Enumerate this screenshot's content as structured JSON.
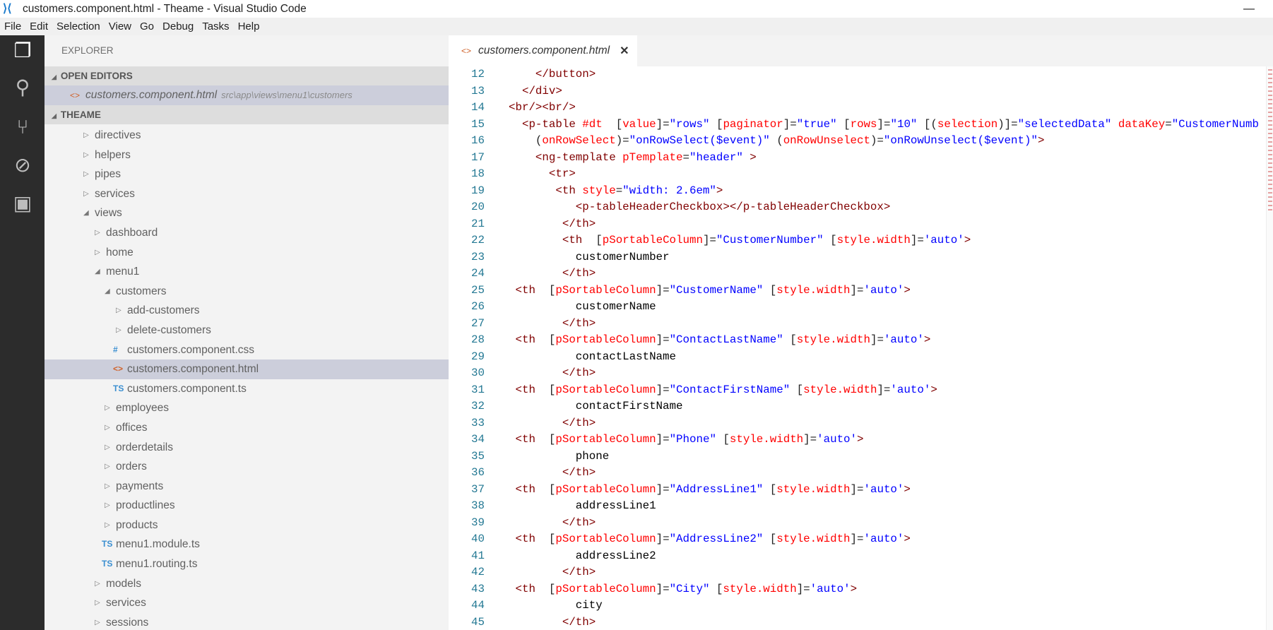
{
  "window": {
    "title": "customers.component.html - Theame - Visual Studio Code",
    "minimize": "—",
    "app_icon": "vscode-logo-icon"
  },
  "menu": [
    "File",
    "Edit",
    "Selection",
    "View",
    "Go",
    "Debug",
    "Tasks",
    "Help"
  ],
  "activity": [
    "files-icon",
    "search-icon",
    "source-control-icon",
    "debug-icon",
    "extensions-icon"
  ],
  "sidebar": {
    "title": "EXPLORER",
    "open_editors": {
      "label": "OPEN EDITORS",
      "file": "customers.component.html",
      "path": "src\\app\\views\\menu1\\customers"
    },
    "project": {
      "label": "THEAME"
    },
    "tree": [
      {
        "label": "directives",
        "level": 0,
        "type": "folder",
        "expanded": false
      },
      {
        "label": "helpers",
        "level": 0,
        "type": "folder",
        "expanded": false
      },
      {
        "label": "pipes",
        "level": 0,
        "type": "folder",
        "expanded": false
      },
      {
        "label": "services",
        "level": 0,
        "type": "folder",
        "expanded": false
      },
      {
        "label": "views",
        "level": 0,
        "type": "folder",
        "expanded": true
      },
      {
        "label": "dashboard",
        "level": 1,
        "type": "folder",
        "expanded": false
      },
      {
        "label": "home",
        "level": 1,
        "type": "folder",
        "expanded": false
      },
      {
        "label": "menu1",
        "level": 1,
        "type": "folder",
        "expanded": true
      },
      {
        "label": "customers",
        "level": 2,
        "type": "folder",
        "expanded": true
      },
      {
        "label": "add-customers",
        "level": 3,
        "type": "folder",
        "expanded": false
      },
      {
        "label": "delete-customers",
        "level": 3,
        "type": "folder",
        "expanded": false
      },
      {
        "label": "customers.component.css",
        "level": 3,
        "type": "css"
      },
      {
        "label": "customers.component.html",
        "level": 3,
        "type": "html",
        "selected": true
      },
      {
        "label": "customers.component.ts",
        "level": 3,
        "type": "ts"
      },
      {
        "label": "employees",
        "level": 2,
        "type": "folder",
        "expanded": false
      },
      {
        "label": "offices",
        "level": 2,
        "type": "folder",
        "expanded": false
      },
      {
        "label": "orderdetails",
        "level": 2,
        "type": "folder",
        "expanded": false
      },
      {
        "label": "orders",
        "level": 2,
        "type": "folder",
        "expanded": false
      },
      {
        "label": "payments",
        "level": 2,
        "type": "folder",
        "expanded": false
      },
      {
        "label": "productlines",
        "level": 2,
        "type": "folder",
        "expanded": false
      },
      {
        "label": "products",
        "level": 2,
        "type": "folder",
        "expanded": false
      },
      {
        "label": "menu1.module.ts",
        "level": 2,
        "type": "ts"
      },
      {
        "label": "menu1.routing.ts",
        "level": 2,
        "type": "ts"
      },
      {
        "label": "models",
        "level": 1,
        "type": "folder",
        "expanded": false
      },
      {
        "label": "services",
        "level": 1,
        "type": "folder",
        "expanded": false
      },
      {
        "label": "sessions",
        "level": 1,
        "type": "folder",
        "expanded": false
      }
    ]
  },
  "editor": {
    "tab": {
      "label": "customers.component.html",
      "close": "✕"
    },
    "colors": {
      "tag": "#800000",
      "attr": "#ff0000",
      "string": "#0000ff",
      "line_number": "#237893"
    },
    "lines": [
      {
        "n": "12",
        "i": 4,
        "tk": [
          [
            "t",
            "</button>"
          ]
        ]
      },
      {
        "n": "13",
        "i": 2,
        "tk": [
          [
            "t",
            "</div>"
          ]
        ]
      },
      {
        "n": "14",
        "i": 0,
        "tk": [
          [
            "t",
            "<br/><br/>"
          ]
        ]
      },
      {
        "n": "15",
        "i": 2,
        "tk": [
          [
            "t",
            "<p-table "
          ],
          [
            "a",
            "#dt"
          ],
          [
            "p",
            "  ["
          ],
          [
            "a",
            "value"
          ],
          [
            "p",
            "]="
          ],
          [
            "s",
            "\"rows\""
          ],
          [
            "p",
            " ["
          ],
          [
            "a",
            "paginator"
          ],
          [
            "p",
            "]="
          ],
          [
            "s",
            "\"true\""
          ],
          [
            "p",
            " ["
          ],
          [
            "a",
            "rows"
          ],
          [
            "p",
            "]="
          ],
          [
            "s",
            "\"10\""
          ],
          [
            "p",
            " [("
          ],
          [
            "a",
            "selection"
          ],
          [
            "p",
            ")]="
          ],
          [
            "s",
            "\"selectedData\""
          ],
          [
            "p",
            " "
          ],
          [
            "a",
            "dataKey"
          ],
          [
            "p",
            "="
          ],
          [
            "s",
            "\"CustomerNumb"
          ]
        ]
      },
      {
        "n": "16",
        "i": 4,
        "tk": [
          [
            "p",
            "("
          ],
          [
            "a",
            "onRowSelect"
          ],
          [
            "p",
            ")="
          ],
          [
            "s",
            "\"onRowSelect($event)\""
          ],
          [
            "p",
            " ("
          ],
          [
            "a",
            "onRowUnselect"
          ],
          [
            "p",
            ")="
          ],
          [
            "s",
            "\"onRowUnselect($event)\""
          ],
          [
            "t",
            ">"
          ]
        ]
      },
      {
        "n": "17",
        "i": 4,
        "tk": [
          [
            "t",
            "<ng-template "
          ],
          [
            "a",
            "pTemplate"
          ],
          [
            "p",
            "="
          ],
          [
            "s",
            "\"header\""
          ],
          [
            "t",
            " >"
          ]
        ]
      },
      {
        "n": "18",
        "i": 6,
        "tk": [
          [
            "t",
            "<tr>"
          ]
        ]
      },
      {
        "n": "19",
        "i": 7,
        "tk": [
          [
            "t",
            "<th "
          ],
          [
            "a",
            "style"
          ],
          [
            "p",
            "="
          ],
          [
            "s",
            "\"width: 2.6em\""
          ],
          [
            "t",
            ">"
          ]
        ]
      },
      {
        "n": "20",
        "i": 10,
        "tk": [
          [
            "t",
            "<p-tableHeaderCheckbox></p-tableHeaderCheckbox>"
          ]
        ]
      },
      {
        "n": "21",
        "i": 8,
        "tk": [
          [
            "t",
            "</th>"
          ]
        ]
      },
      {
        "n": "22",
        "i": 8,
        "tk": [
          [
            "t",
            "<th"
          ],
          [
            "p",
            "  ["
          ],
          [
            "a",
            "pSortableColumn"
          ],
          [
            "p",
            "]="
          ],
          [
            "s",
            "\"CustomerNumber\""
          ],
          [
            "p",
            " ["
          ],
          [
            "a",
            "style.width"
          ],
          [
            "p",
            "]="
          ],
          [
            "s",
            "'auto'"
          ],
          [
            "t",
            ">"
          ]
        ]
      },
      {
        "n": "23",
        "i": 10,
        "tk": [
          [
            "x",
            "customerNumber"
          ]
        ]
      },
      {
        "n": "24",
        "i": 8,
        "tk": [
          [
            "t",
            "</th>"
          ]
        ]
      },
      {
        "n": "25",
        "i": 1,
        "tk": [
          [
            "t",
            "<th"
          ],
          [
            "p",
            "  ["
          ],
          [
            "a",
            "pSortableColumn"
          ],
          [
            "p",
            "]="
          ],
          [
            "s",
            "\"CustomerName\""
          ],
          [
            "p",
            " ["
          ],
          [
            "a",
            "style.width"
          ],
          [
            "p",
            "]="
          ],
          [
            "s",
            "'auto'"
          ],
          [
            "t",
            ">"
          ]
        ]
      },
      {
        "n": "26",
        "i": 10,
        "tk": [
          [
            "x",
            "customerName"
          ]
        ]
      },
      {
        "n": "27",
        "i": 8,
        "tk": [
          [
            "t",
            "</th>"
          ]
        ]
      },
      {
        "n": "28",
        "i": 1,
        "tk": [
          [
            "t",
            "<th"
          ],
          [
            "p",
            "  ["
          ],
          [
            "a",
            "pSortableColumn"
          ],
          [
            "p",
            "]="
          ],
          [
            "s",
            "\"ContactLastName\""
          ],
          [
            "p",
            " ["
          ],
          [
            "a",
            "style.width"
          ],
          [
            "p",
            "]="
          ],
          [
            "s",
            "'auto'"
          ],
          [
            "t",
            ">"
          ]
        ]
      },
      {
        "n": "29",
        "i": 10,
        "tk": [
          [
            "x",
            "contactLastName"
          ]
        ]
      },
      {
        "n": "30",
        "i": 8,
        "tk": [
          [
            "t",
            "</th>"
          ]
        ]
      },
      {
        "n": "31",
        "i": 1,
        "tk": [
          [
            "t",
            "<th"
          ],
          [
            "p",
            "  ["
          ],
          [
            "a",
            "pSortableColumn"
          ],
          [
            "p",
            "]="
          ],
          [
            "s",
            "\"ContactFirstName\""
          ],
          [
            "p",
            " ["
          ],
          [
            "a",
            "style.width"
          ],
          [
            "p",
            "]="
          ],
          [
            "s",
            "'auto'"
          ],
          [
            "t",
            ">"
          ]
        ]
      },
      {
        "n": "32",
        "i": 10,
        "tk": [
          [
            "x",
            "contactFirstName"
          ]
        ]
      },
      {
        "n": "33",
        "i": 8,
        "tk": [
          [
            "t",
            "</th>"
          ]
        ]
      },
      {
        "n": "34",
        "i": 1,
        "tk": [
          [
            "t",
            "<th"
          ],
          [
            "p",
            "  ["
          ],
          [
            "a",
            "pSortableColumn"
          ],
          [
            "p",
            "]="
          ],
          [
            "s",
            "\"Phone\""
          ],
          [
            "p",
            " ["
          ],
          [
            "a",
            "style.width"
          ],
          [
            "p",
            "]="
          ],
          [
            "s",
            "'auto'"
          ],
          [
            "t",
            ">"
          ]
        ]
      },
      {
        "n": "35",
        "i": 10,
        "tk": [
          [
            "x",
            "phone"
          ]
        ]
      },
      {
        "n": "36",
        "i": 8,
        "tk": [
          [
            "t",
            "</th>"
          ]
        ]
      },
      {
        "n": "37",
        "i": 1,
        "tk": [
          [
            "t",
            "<th"
          ],
          [
            "p",
            "  ["
          ],
          [
            "a",
            "pSortableColumn"
          ],
          [
            "p",
            "]="
          ],
          [
            "s",
            "\"AddressLine1\""
          ],
          [
            "p",
            " ["
          ],
          [
            "a",
            "style.width"
          ],
          [
            "p",
            "]="
          ],
          [
            "s",
            "'auto'"
          ],
          [
            "t",
            ">"
          ]
        ]
      },
      {
        "n": "38",
        "i": 10,
        "tk": [
          [
            "x",
            "addressLine1"
          ]
        ]
      },
      {
        "n": "39",
        "i": 8,
        "tk": [
          [
            "t",
            "</th>"
          ]
        ]
      },
      {
        "n": "40",
        "i": 1,
        "tk": [
          [
            "t",
            "<th"
          ],
          [
            "p",
            "  ["
          ],
          [
            "a",
            "pSortableColumn"
          ],
          [
            "p",
            "]="
          ],
          [
            "s",
            "\"AddressLine2\""
          ],
          [
            "p",
            " ["
          ],
          [
            "a",
            "style.width"
          ],
          [
            "p",
            "]="
          ],
          [
            "s",
            "'auto'"
          ],
          [
            "t",
            ">"
          ]
        ]
      },
      {
        "n": "41",
        "i": 10,
        "tk": [
          [
            "x",
            "addressLine2"
          ]
        ]
      },
      {
        "n": "42",
        "i": 8,
        "tk": [
          [
            "t",
            "</th>"
          ]
        ]
      },
      {
        "n": "43",
        "i": 1,
        "tk": [
          [
            "t",
            "<th"
          ],
          [
            "p",
            "  ["
          ],
          [
            "a",
            "pSortableColumn"
          ],
          [
            "p",
            "]="
          ],
          [
            "s",
            "\"City\""
          ],
          [
            "p",
            " ["
          ],
          [
            "a",
            "style.width"
          ],
          [
            "p",
            "]="
          ],
          [
            "s",
            "'auto'"
          ],
          [
            "t",
            ">"
          ]
        ]
      },
      {
        "n": "44",
        "i": 10,
        "tk": [
          [
            "x",
            "city"
          ]
        ]
      },
      {
        "n": "45",
        "i": 8,
        "tk": [
          [
            "t",
            "</th>"
          ]
        ]
      }
    ]
  }
}
